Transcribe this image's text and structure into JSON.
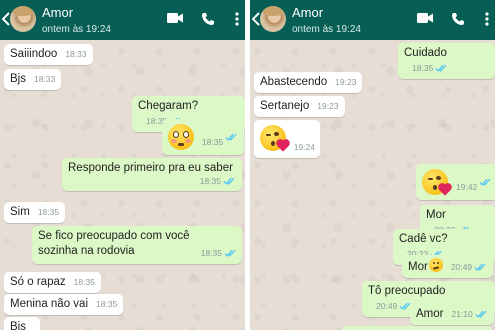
{
  "contact": {
    "name": "Amor",
    "status": "ontem às 19:24"
  },
  "colors": {
    "header": "#075e54",
    "chat_background": "#e6ded5",
    "incoming_bubble": "#ffffff",
    "outgoing_bubble": "#dcf8c6",
    "read_ticks": "#4fc3f7"
  },
  "icons": [
    "back-arrow-icon",
    "video-call-icon",
    "phone-icon",
    "more-options-icon",
    "double-check-icon"
  ],
  "left_chat": [
    {
      "dir": "in",
      "text": "Saiiindoo",
      "time": "18:33"
    },
    {
      "dir": "in",
      "text": "Bjs",
      "time": "18:33"
    },
    {
      "dir": "out",
      "text": "Chegaram?",
      "time": "18:35"
    },
    {
      "dir": "out",
      "emoji": "flushed-face",
      "time": "18:35"
    },
    {
      "dir": "out",
      "text": "Responde primeiro pra eu saber",
      "time": "18:35"
    },
    {
      "dir": "in",
      "text": "Sim",
      "time": "18:35"
    },
    {
      "dir": "out",
      "text": "Se fico preocupado com você\nsozinha na rodovia",
      "time": "18:35"
    },
    {
      "dir": "in",
      "text": "Só o rapaz",
      "time": "18:35"
    },
    {
      "dir": "in",
      "text": "Menina não vai",
      "time": "18:35"
    },
    {
      "dir": "in",
      "text": "Bjs",
      "time": ""
    }
  ],
  "right_chat": [
    {
      "dir": "out",
      "text": "Cuidado",
      "time": "18:35"
    },
    {
      "dir": "in",
      "text": "Abastecendo",
      "time": "19:23"
    },
    {
      "dir": "in",
      "text": "Sertanejo",
      "time": "19:23"
    },
    {
      "dir": "in",
      "emoji": "face-blowing-kiss",
      "time": "19:24"
    },
    {
      "dir": "out",
      "emoji": "face-blowing-kiss",
      "time": "19:42"
    },
    {
      "dir": "out",
      "text": "Mor",
      "time": "20:23"
    },
    {
      "dir": "out",
      "text": "Cadê vc?",
      "time": "20:23"
    },
    {
      "dir": "out",
      "text": "Mor",
      "emoji": "confused-face",
      "time": "20:49"
    },
    {
      "dir": "out",
      "text": "Tô preocupado",
      "time": "20:49"
    },
    {
      "dir": "out",
      "text": "Amor",
      "time": "21:10"
    }
  ]
}
